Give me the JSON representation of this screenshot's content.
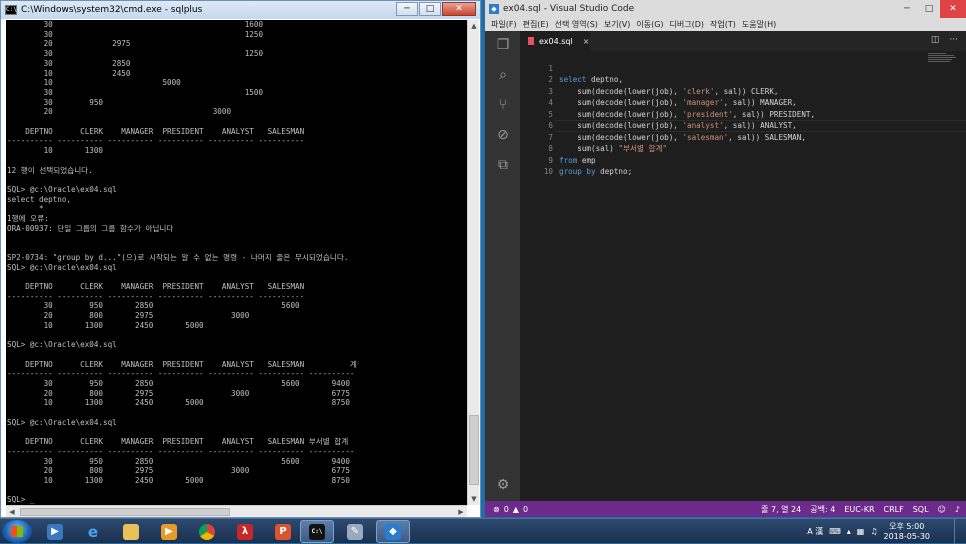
{
  "cmd": {
    "title": "C:\\Windows\\system32\\cmd.exe - sqlplus",
    "controls": {
      "minimize": "─",
      "maximize": "□",
      "close": "✕"
    },
    "lines": [
      "        30                                          1600",
      "        30                                          1250",
      "        20             2975",
      "        30                                          1250",
      "        30             2850",
      "        10             2450",
      "        10                        5000",
      "        30                                          1500",
      "        30        950",
      "        20                                   3000",
      "",
      "    DEPTNO      CLERK    MANAGER  PRESIDENT    ANALYST   SALESMAN",
      "---------- ---------- ---------- ---------- ---------- ----------",
      "        10       1300",
      "",
      "12 행이 선택되었습니다.",
      "",
      "SQL> @c:\\Oracle\\ex04.sql",
      "select deptno,",
      "       *",
      "1행에 오류:",
      "ORA-00937: 단일 그룹의 그룹 함수가 아닙니다",
      "",
      "",
      "SP2-0734: \"group by d...\"(으)로 시작되는 알 수 없는 명령 - 나머지 줄은 무시되었습니다.",
      "SQL> @c:\\Oracle\\ex04.sql",
      "",
      "    DEPTNO      CLERK    MANAGER  PRESIDENT    ANALYST   SALESMAN",
      "---------- ---------- ---------- ---------- ---------- ----------",
      "        30        950       2850                            5600",
      "        20        800       2975                 3000",
      "        10       1300       2450       5000",
      "",
      "SQL> @c:\\Oracle\\ex04.sql",
      "",
      "    DEPTNO      CLERK    MANAGER  PRESIDENT    ANALYST   SALESMAN          계",
      "---------- ---------- ---------- ---------- ---------- ---------- ----------",
      "        30        950       2850                            5600       9400",
      "        20        800       2975                 3000                  6775",
      "        10       1300       2450       5000                            8750",
      "",
      "SQL> @c:\\Oracle\\ex04.sql",
      "",
      "    DEPTNO      CLERK    MANAGER  PRESIDENT    ANALYST   SALESMAN 부서별 합계",
      "---------- ---------- ---------- ---------- ---------- ---------- ----------",
      "        30        950       2850                            5600       9400",
      "        20        800       2975                 3000                  6775",
      "        10       1300       2450       5000                            8750",
      "",
      "SQL> _"
    ]
  },
  "vscode": {
    "title": "ex04.sql - Visual Studio Code",
    "controls": {
      "minimize": "─",
      "maximize": "□",
      "close": "✕"
    },
    "menu": [
      "파일(F)",
      "편집(E)",
      "선택 영역(S)",
      "보기(V)",
      "이동(G)",
      "디버그(D)",
      "작업(T)",
      "도움말(H)"
    ],
    "tab": {
      "label": "ex04.sql",
      "close": "×"
    },
    "line_numbers": [
      "1",
      "2",
      "3",
      "4",
      "5",
      "6",
      "7",
      "8",
      "9",
      "10"
    ],
    "status": {
      "errors": "0",
      "warnings": "0",
      "position": "줄 7, 열 24",
      "spaces": "공백: 4",
      "encoding": "EUC-KR",
      "eol": "CRLF",
      "language": "SQL"
    }
  },
  "taskbar": {
    "tray_lang": "A 漢",
    "time": "오후 5:00",
    "date": "2018-05-30"
  }
}
